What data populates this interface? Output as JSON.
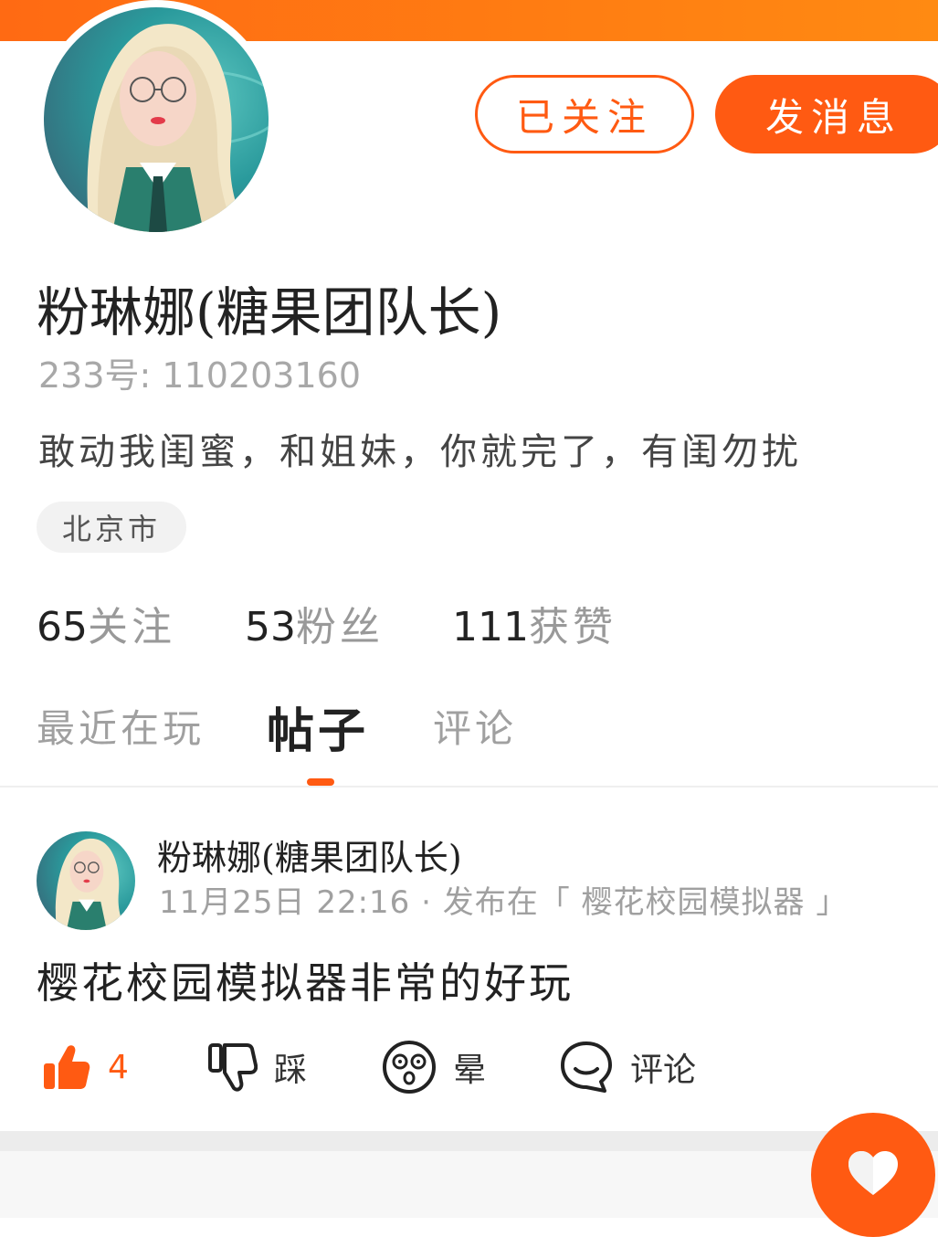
{
  "profile": {
    "nickname": "粉琳娜(糖果团队长)",
    "uid": "233号: 110203160",
    "bio": "敢动我闺蜜，和姐妹，你就完了，有闺勿扰",
    "location": "北京市"
  },
  "buttons": {
    "follow_label": "已关注",
    "message_label": "发消息"
  },
  "stats": {
    "following_count": "65",
    "following_label": "关注",
    "fans_count": "53",
    "fans_label": "粉丝",
    "likes_count": "111",
    "likes_label": "获赞"
  },
  "tabs": [
    "最近在玩",
    "帖子",
    "评论"
  ],
  "active_tab": "帖子",
  "post": {
    "author": "粉琳娜(糖果团队长)",
    "meta": "11月25日 22:16 · 发布在「 樱花校园模拟器 」",
    "content": "樱花校园模拟器非常的好玩",
    "like_count": "4",
    "dislike_label": "踩",
    "dizzy_label": "晕",
    "comment_label": "评论"
  },
  "colors": {
    "accent": "#ff5a12",
    "banner": "#ff7a12"
  },
  "icons": {
    "like": "thumbs-up-icon",
    "dislike": "thumbs-down-icon",
    "dizzy": "dizzy-face-icon",
    "comment": "comment-bubble-icon",
    "fab": "heart-icon"
  }
}
